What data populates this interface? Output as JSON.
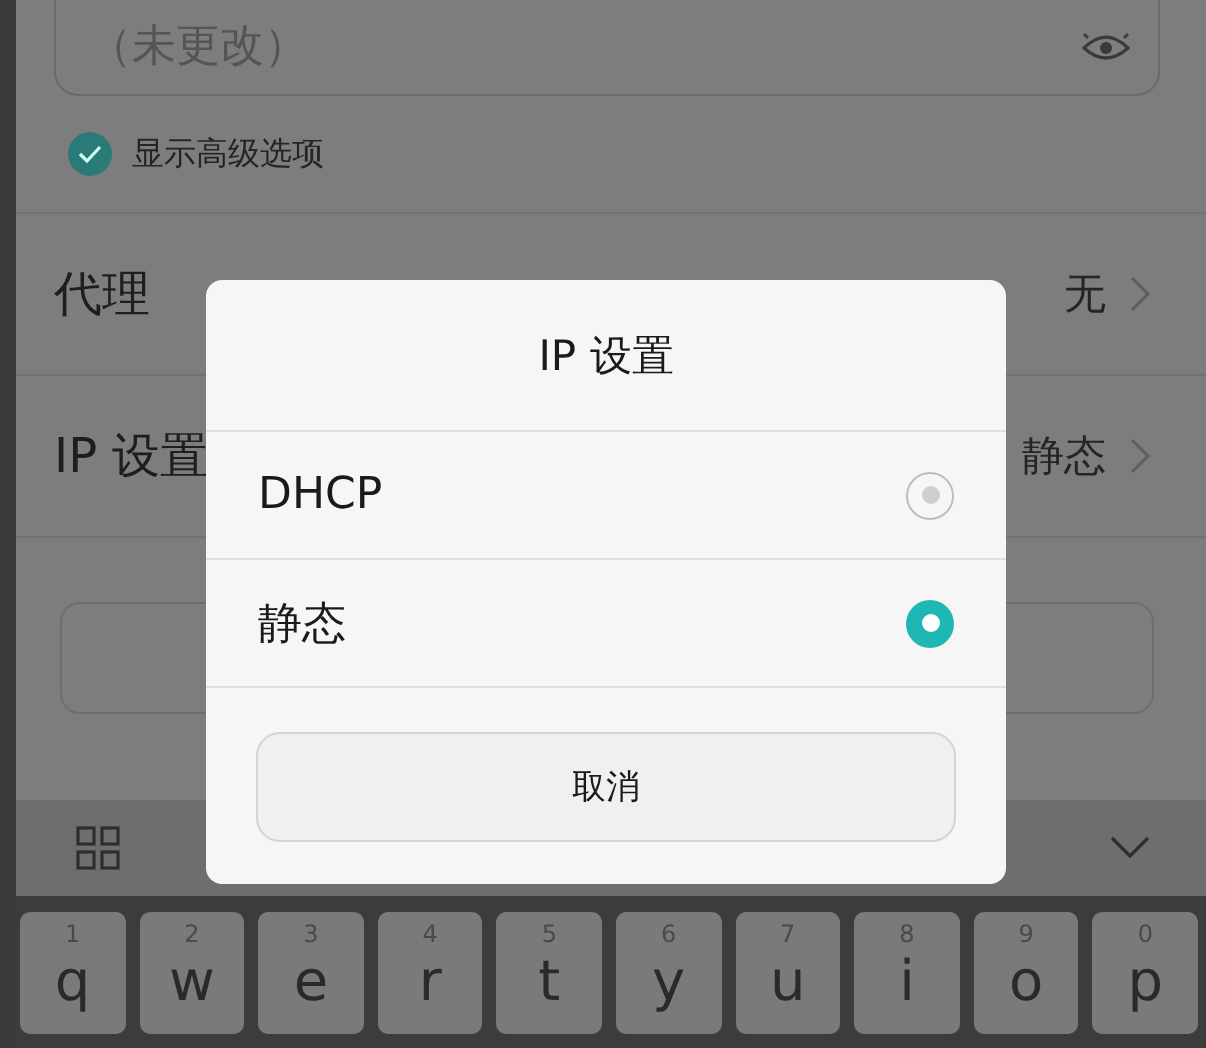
{
  "password_field": {
    "placeholder": "（未更改）"
  },
  "advanced_checkbox": {
    "label": "显示高级选项",
    "checked": true
  },
  "settings_rows": [
    {
      "label": "代理",
      "value": "无"
    },
    {
      "label": "IP 设置",
      "value": "静态"
    }
  ],
  "dialog": {
    "title": "IP 设置",
    "options": [
      {
        "label": "DHCP",
        "selected": false
      },
      {
        "label": "静态",
        "selected": true
      }
    ],
    "cancel_button": "取消"
  },
  "keyboard": {
    "keys": [
      {
        "letter": "q",
        "digit": "1"
      },
      {
        "letter": "w",
        "digit": "2"
      },
      {
        "letter": "e",
        "digit": "3"
      },
      {
        "letter": "r",
        "digit": "4"
      },
      {
        "letter": "t",
        "digit": "5"
      },
      {
        "letter": "y",
        "digit": "6"
      },
      {
        "letter": "u",
        "digit": "7"
      },
      {
        "letter": "i",
        "digit": "8"
      },
      {
        "letter": "o",
        "digit": "9"
      },
      {
        "letter": "p",
        "digit": "0"
      }
    ]
  }
}
